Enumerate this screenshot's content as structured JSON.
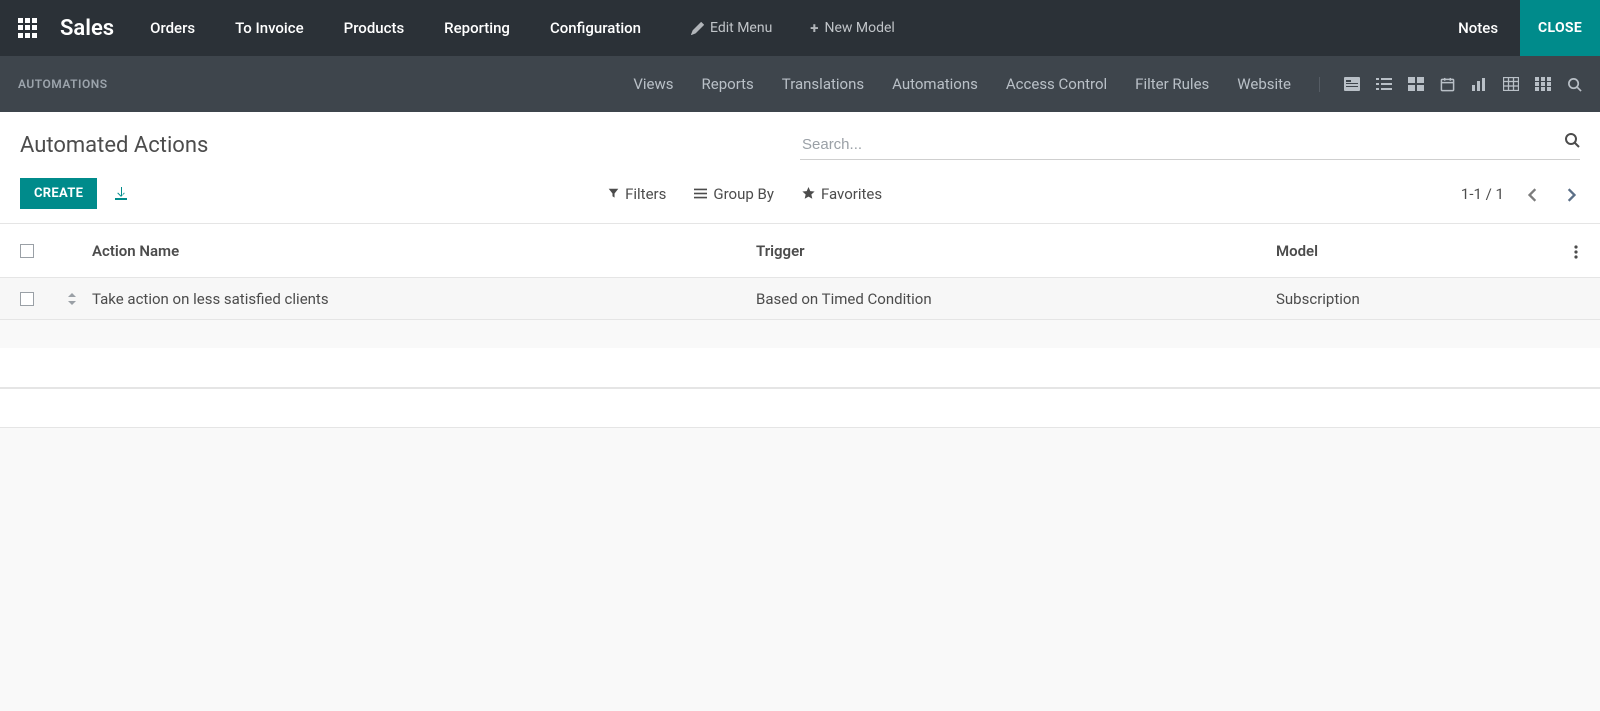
{
  "navbar": {
    "brand": "Sales",
    "menu": [
      "Orders",
      "To Invoice",
      "Products",
      "Reporting",
      "Configuration"
    ],
    "edit_menu": "Edit Menu",
    "new_model": "New Model",
    "notes": "Notes",
    "close": "CLOSE"
  },
  "subnav": {
    "title": "AUTOMATIONS",
    "links": [
      "Views",
      "Reports",
      "Translations",
      "Automations",
      "Access Control",
      "Filter Rules",
      "Website"
    ]
  },
  "control": {
    "page_title": "Automated Actions",
    "search_placeholder": "Search...",
    "create": "CREATE",
    "filters": "Filters",
    "group_by": "Group By",
    "favorites": "Favorites",
    "pager": "1-1 / 1"
  },
  "table": {
    "columns": {
      "action_name": "Action Name",
      "trigger": "Trigger",
      "model": "Model"
    },
    "rows": [
      {
        "action_name": "Take action on less satisfied clients",
        "trigger": "Based on Timed Condition",
        "model": "Subscription"
      }
    ]
  }
}
